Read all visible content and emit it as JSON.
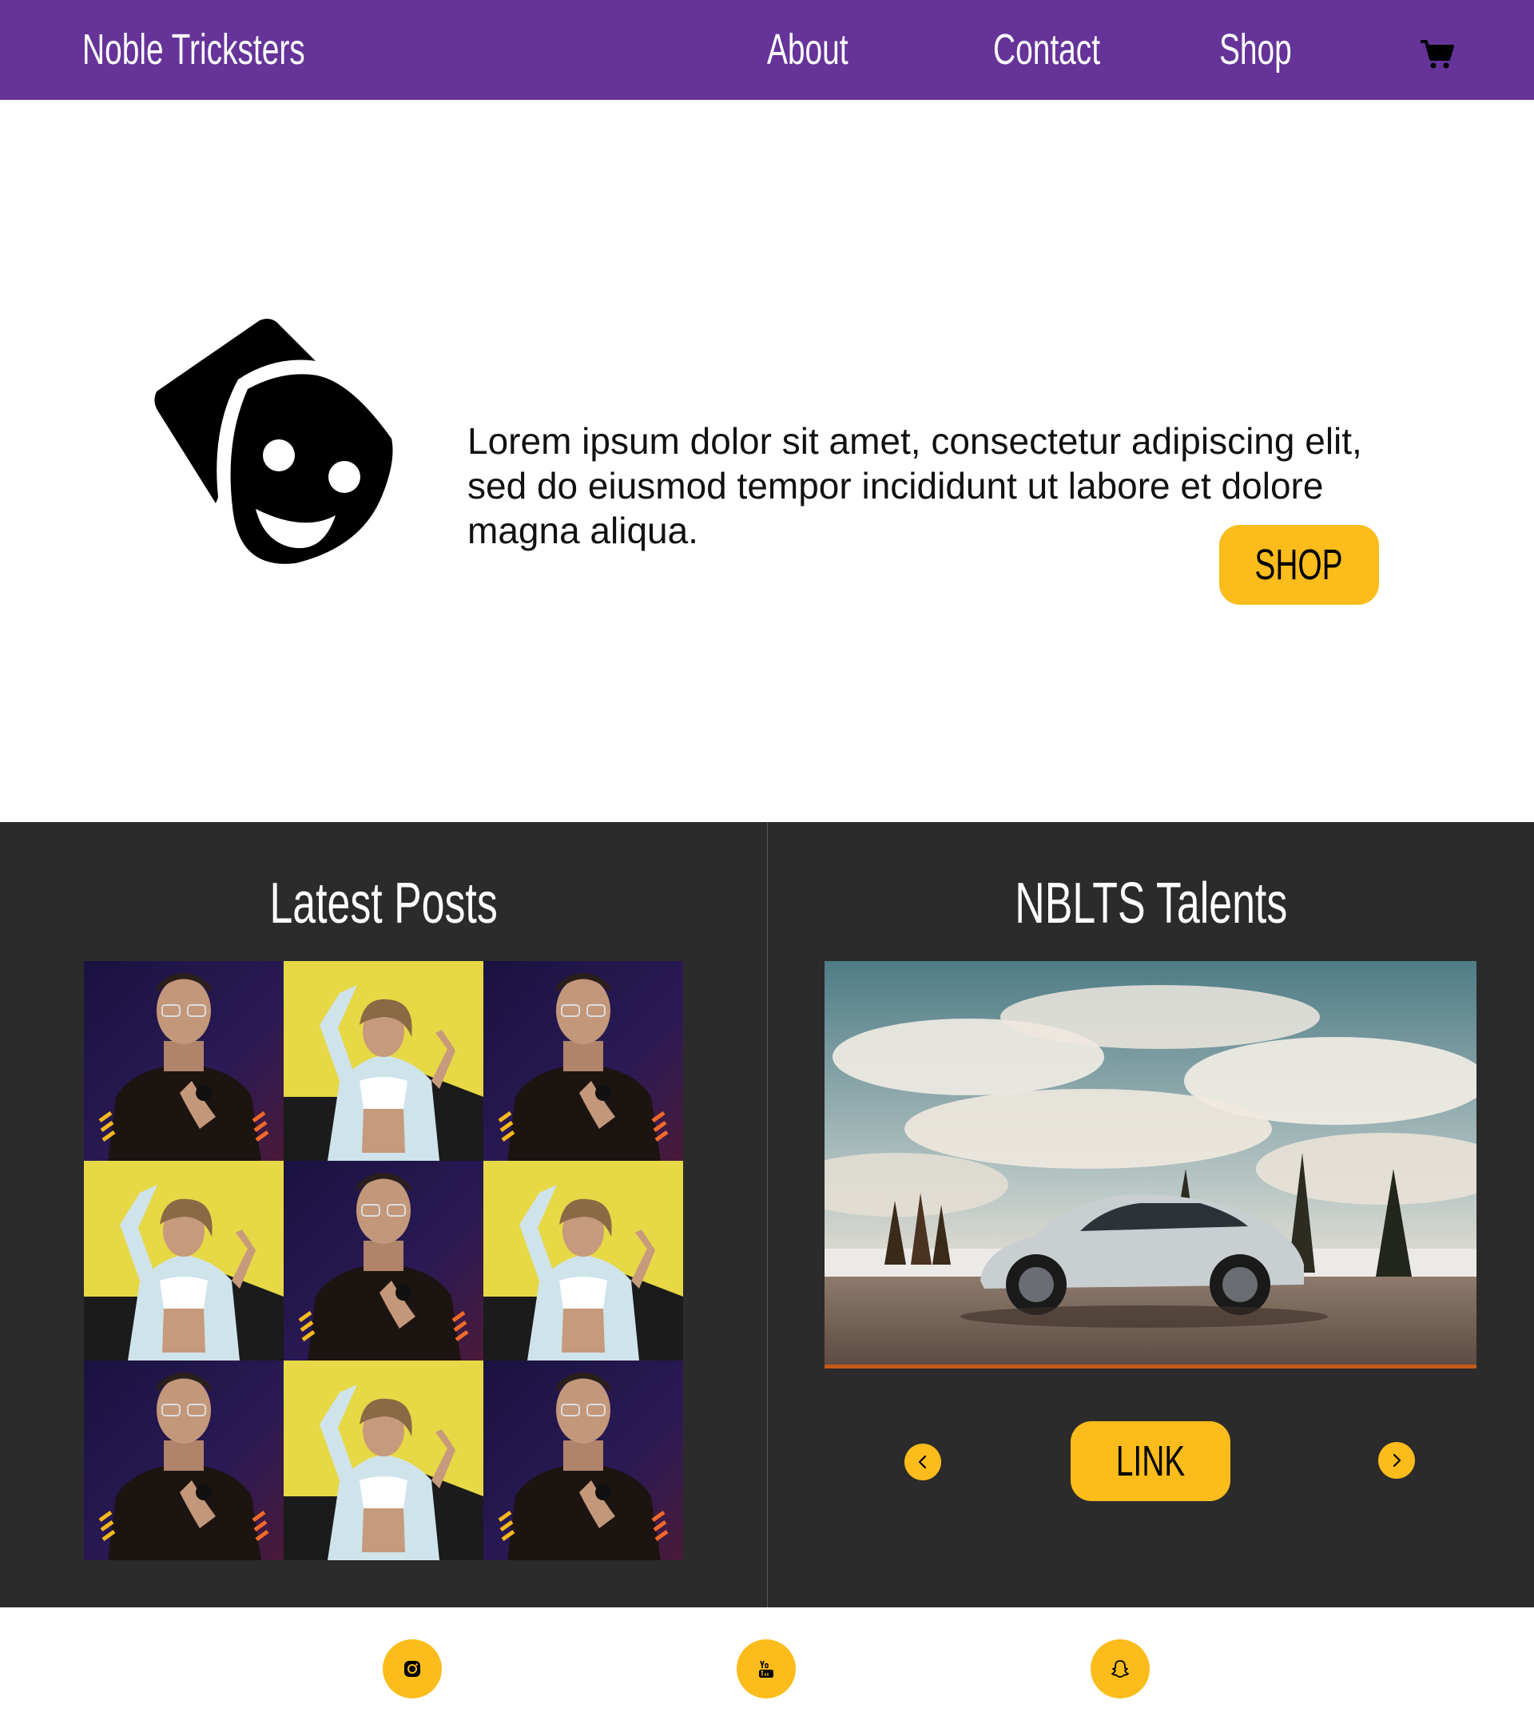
{
  "nav": {
    "brand": "Noble Tricksters",
    "links": [
      {
        "label": "About"
      },
      {
        "label": "Contact"
      },
      {
        "label": "Shop"
      }
    ],
    "cart_icon": "cart-icon"
  },
  "hero": {
    "logo_icon": "theater-masks-icon",
    "text": "Lorem ipsum dolor sit amet, consectetur adipiscing elit, sed do eiusmod tempor incididunt ut labore et dolore magna aliqua.",
    "button_label": "SHOP"
  },
  "latest_posts": {
    "title": "Latest Posts",
    "tiles": [
      "man-purple",
      "woman-yellow",
      "man-purple",
      "woman-yellow",
      "man-purple",
      "woman-yellow",
      "man-purple",
      "woman-yellow",
      "man-purple"
    ]
  },
  "talents": {
    "title": "NBLTS Talents",
    "image": "car-landscape-photo",
    "button_label": "LINK",
    "prev_icon": "chevron-left-icon",
    "next_icon": "chevron-right-icon"
  },
  "footer": {
    "social": [
      "instagram-icon",
      "youtube-icon",
      "snapchat-icon"
    ]
  },
  "colors": {
    "nav_bg": "#663399",
    "accent": "#fbbc1c",
    "dark_bg": "#2b2b2b",
    "text_light": "#ffffff"
  }
}
